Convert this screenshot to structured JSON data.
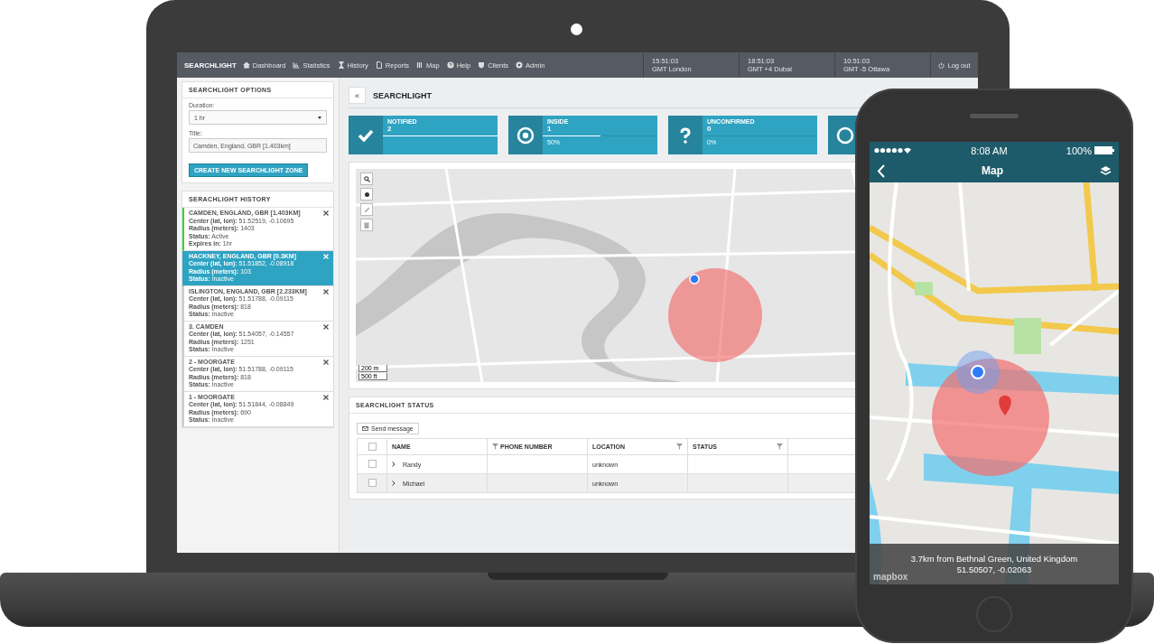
{
  "laptop": {
    "nav": {
      "brand": "SEARCHLIGHT",
      "items": [
        {
          "label": "Dashboard"
        },
        {
          "label": "Statistics"
        },
        {
          "label": "History"
        },
        {
          "label": "Reports"
        },
        {
          "label": "Map"
        },
        {
          "label": "Help"
        },
        {
          "label": "Clients"
        },
        {
          "label": "Admin"
        }
      ],
      "clocks": [
        {
          "time": "15:51:03",
          "zone": "GMT London"
        },
        {
          "time": "18:51:03",
          "zone": "GMT +4 Dubai"
        },
        {
          "time": "10:51:03",
          "zone": "GMT -5 Ottawa"
        }
      ],
      "logout": "Log out"
    },
    "options": {
      "title": "SEARCHLIGHT OPTIONS",
      "duration_label": "Duration:",
      "duration_value": "1 hr",
      "title_label": "Title:",
      "title_value": "Camden, England, GBR [1.403km]",
      "create_button": "CREATE NEW SEARCHLIGHT ZONE"
    },
    "history": {
      "title": "SERACHLIGHT HISTORY",
      "items": [
        {
          "name": "CAMDEN, ENGLAND, GBR [1.403KM]",
          "active": true,
          "selected": false,
          "lines": [
            {
              "label": "Center (lat, lon):",
              "value": "51.52519, -0.10695"
            },
            {
              "label": "Radius (meters):",
              "value": "1403"
            },
            {
              "label": "Status:",
              "value": "Active"
            },
            {
              "label": "Expires in:",
              "value": "1hr"
            }
          ]
        },
        {
          "name": "HACKNEY, ENGLAND, GBR [0.3KM]",
          "active": false,
          "selected": true,
          "lines": [
            {
              "label": "Center (lat, lon):",
              "value": "51.51852, -0.08918"
            },
            {
              "label": "Radius (meters):",
              "value": "103"
            },
            {
              "label": "Status:",
              "value": "Inactive"
            }
          ]
        },
        {
          "name": "ISLINGTON, ENGLAND, GBR [2.233KM]",
          "active": false,
          "selected": false,
          "lines": [
            {
              "label": "Center (lat, lon):",
              "value": "51.51788, -0.09115"
            },
            {
              "label": "Radius (meters):",
              "value": "818"
            },
            {
              "label": "Status:",
              "value": "Inactive"
            }
          ]
        },
        {
          "name": "3. CAMDEN",
          "active": false,
          "selected": false,
          "lines": [
            {
              "label": "Center (lat, lon):",
              "value": "51.54057, -0.14557"
            },
            {
              "label": "Radius (meters):",
              "value": "1251"
            },
            {
              "label": "Status:",
              "value": "Inactive"
            }
          ]
        },
        {
          "name": "2 - MOORGATE",
          "active": false,
          "selected": false,
          "lines": [
            {
              "label": "Center (lat, lon):",
              "value": "51.51788, -0.09115"
            },
            {
              "label": "Radius (meters):",
              "value": "818"
            },
            {
              "label": "Status:",
              "value": "Inactive"
            }
          ]
        },
        {
          "name": "1 - MOORGATE",
          "active": false,
          "selected": false,
          "lines": [
            {
              "label": "Center (lat, lon):",
              "value": "51.51844, -0.08849"
            },
            {
              "label": "Radius (meters):",
              "value": "690"
            },
            {
              "label": "Status:",
              "value": "Inactive"
            }
          ]
        }
      ]
    },
    "header": {
      "back": "«",
      "title": "SEARCHLIGHT"
    },
    "stats": [
      {
        "label": "NOTIFIED",
        "value": "2",
        "level": 1
      },
      {
        "label": "INSIDE",
        "value": "1",
        "level": 0.5,
        "percent": "50%"
      },
      {
        "label": "UNCONFIRMED",
        "value": "0",
        "level": 0,
        "percent": "0%"
      }
    ],
    "map": {
      "scale": [
        "200 m",
        "500 ft"
      ]
    },
    "status": {
      "title": "SEARCHLIGHT STATUS",
      "send_button": "Send message",
      "select_all_checked": false,
      "columns": [
        {
          "label": "NAME"
        },
        {
          "label": "PHONE NUMBER"
        },
        {
          "label": "LOCATION"
        },
        {
          "label": "STATUS"
        }
      ],
      "rows": [
        {
          "checked": false,
          "name": "Randy",
          "location": "unknown"
        },
        {
          "checked": false,
          "name": "Michael",
          "location": "unknown"
        }
      ]
    }
  },
  "phone": {
    "status_bar": {
      "time": "8:08 AM",
      "battery": "100%"
    },
    "nav": {
      "title": "Map"
    },
    "footer": {
      "lines": [
        "3.7km from Bethnal Green, United Kingdom",
        "51.50507, -0.02063"
      ]
    },
    "attribution": "mapbox"
  }
}
